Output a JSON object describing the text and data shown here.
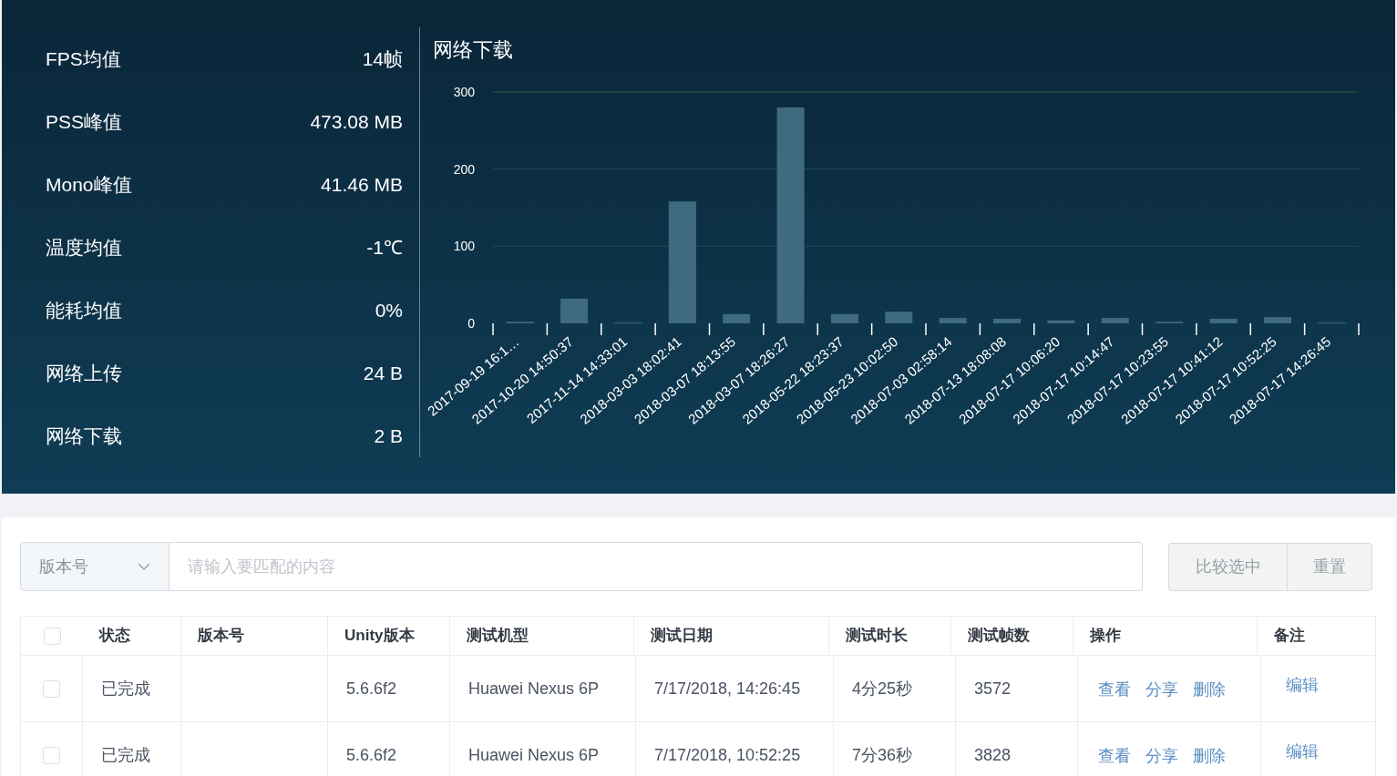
{
  "stats": [
    {
      "label": "FPS均值",
      "value": "14帧"
    },
    {
      "label": "PSS峰值",
      "value": "473.08 MB"
    },
    {
      "label": "Mono峰值",
      "value": "41.46 MB"
    },
    {
      "label": "温度均值",
      "value": "-1℃"
    },
    {
      "label": "能耗均值",
      "value": "0%"
    },
    {
      "label": "网络上传",
      "value": "24 B"
    },
    {
      "label": "网络下载",
      "value": "2 B"
    }
  ],
  "chart_title": "网络下载",
  "chart_data": {
    "type": "bar",
    "categories": [
      "2017-09-19 16:1…",
      "2017-10-20 14:50:37",
      "2017-11-14 14:33:01",
      "2018-03-03 18:02:41",
      "2018-03-07 18:13:55",
      "2018-03-07 18:26:27",
      "2018-05-22 18:23:37",
      "2018-05-23 10:02:50",
      "2018-07-03 02:58:14",
      "2018-07-13 18:08:08",
      "2018-07-17 10:06:20",
      "2018-07-17 10:14:47",
      "2018-07-17 10:23:55",
      "2018-07-17 10:41:12",
      "2018-07-17 10:52:25",
      "2018-07-17 14:26:45"
    ],
    "values": [
      2,
      32,
      1,
      158,
      12,
      280,
      12,
      15,
      7,
      6,
      4,
      7,
      2,
      6,
      8,
      1
    ],
    "ylim": [
      0,
      300
    ],
    "yticks": [
      0,
      100,
      200,
      300
    ]
  },
  "filter": {
    "dropdown": "版本号",
    "placeholder": "请输入要匹配的内容"
  },
  "buttons": [
    "比较选中",
    "重置"
  ],
  "table": {
    "columns": [
      "状态",
      "版本号",
      "Unity版本",
      "测试机型",
      "测试日期",
      "测试时长",
      "测试帧数",
      "操作",
      "备注"
    ],
    "header_checked": false,
    "rows": [
      {
        "checked": false,
        "cells": [
          "已完成",
          "",
          "5.6.6f2",
          "Huawei Nexus 6P",
          "7/17/2018, 14:26:45",
          "4分25秒",
          "3572"
        ],
        "actions": [
          "查看",
          "分享",
          "删除"
        ],
        "note": "编辑"
      },
      {
        "checked": false,
        "cells": [
          "已完成",
          "",
          "5.6.6f2",
          "Huawei Nexus 6P",
          "7/17/2018, 10:52:25",
          "7分36秒",
          "3828"
        ],
        "actions": [
          "查看",
          "分享",
          "删除"
        ],
        "note": "编辑"
      }
    ]
  }
}
